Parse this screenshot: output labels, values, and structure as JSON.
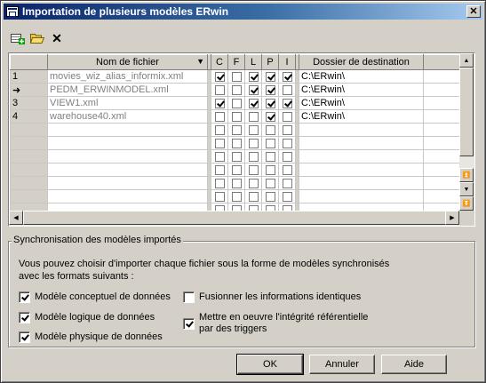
{
  "window": {
    "title": "Importation de plusieurs modèles ERwin",
    "close_glyph": "✕"
  },
  "toolbar": {
    "icons": [
      "add-row-icon",
      "open-folder-icon",
      "delete-icon"
    ],
    "delete_glyph": "✕"
  },
  "grid": {
    "columns": [
      "Nom de fichier",
      "C",
      "F",
      "L",
      "P",
      "I",
      "Dossier de destination"
    ],
    "sort_glyph": "▼",
    "rows": [
      {
        "header": "1",
        "file": "movies_wiz_alias_informix.xml",
        "c": true,
        "f": false,
        "l": true,
        "p": true,
        "i": true,
        "dest": "C:\\ERwin\\"
      },
      {
        "header": "➜",
        "file": "PEDM_ERWINMODEL.xml",
        "c": false,
        "f": false,
        "l": true,
        "p": true,
        "i": false,
        "dest": "C:\\ERwin\\"
      },
      {
        "header": "3",
        "file": "VIEW1.xml",
        "c": true,
        "f": false,
        "l": true,
        "p": true,
        "i": true,
        "dest": "C:\\ERwin\\"
      },
      {
        "header": "4",
        "file": "warehouse40.xml",
        "c": false,
        "f": false,
        "l": false,
        "p": true,
        "i": false,
        "dest": "C:\\ERwin\\"
      }
    ],
    "empty_row_count": 7,
    "scroll_glyphs": {
      "up": "▲",
      "down": "▼",
      "left": "◀",
      "right": "▶",
      "top": "⏫",
      "bottom": "⏬"
    }
  },
  "sync": {
    "legend": "Synchronisation des modèles importés",
    "description_line1": "Vous pouvez choisir d'importer chaque fichier sous la forme de modèles synchronisés",
    "description_line2": "avec les formats suivants :",
    "options": [
      {
        "label": "Modèle conceptuel de données",
        "checked": true
      },
      {
        "label": "Modèle logique de données",
        "checked": true
      },
      {
        "label": "Modèle physique de données",
        "checked": true
      },
      {
        "label": "Fusionner les informations identiques",
        "checked": false
      },
      {
        "label_line1": "Mettre en oeuvre l'intégrité référentielle",
        "label_line2": "par des triggers",
        "checked": true
      }
    ]
  },
  "buttons": {
    "ok": "OK",
    "cancel": "Annuler",
    "help": "Aide"
  },
  "colors": {
    "title_start": "#0a246a",
    "title_end": "#a6caf0",
    "face": "#d4d0c8",
    "file_text": "#808080"
  }
}
